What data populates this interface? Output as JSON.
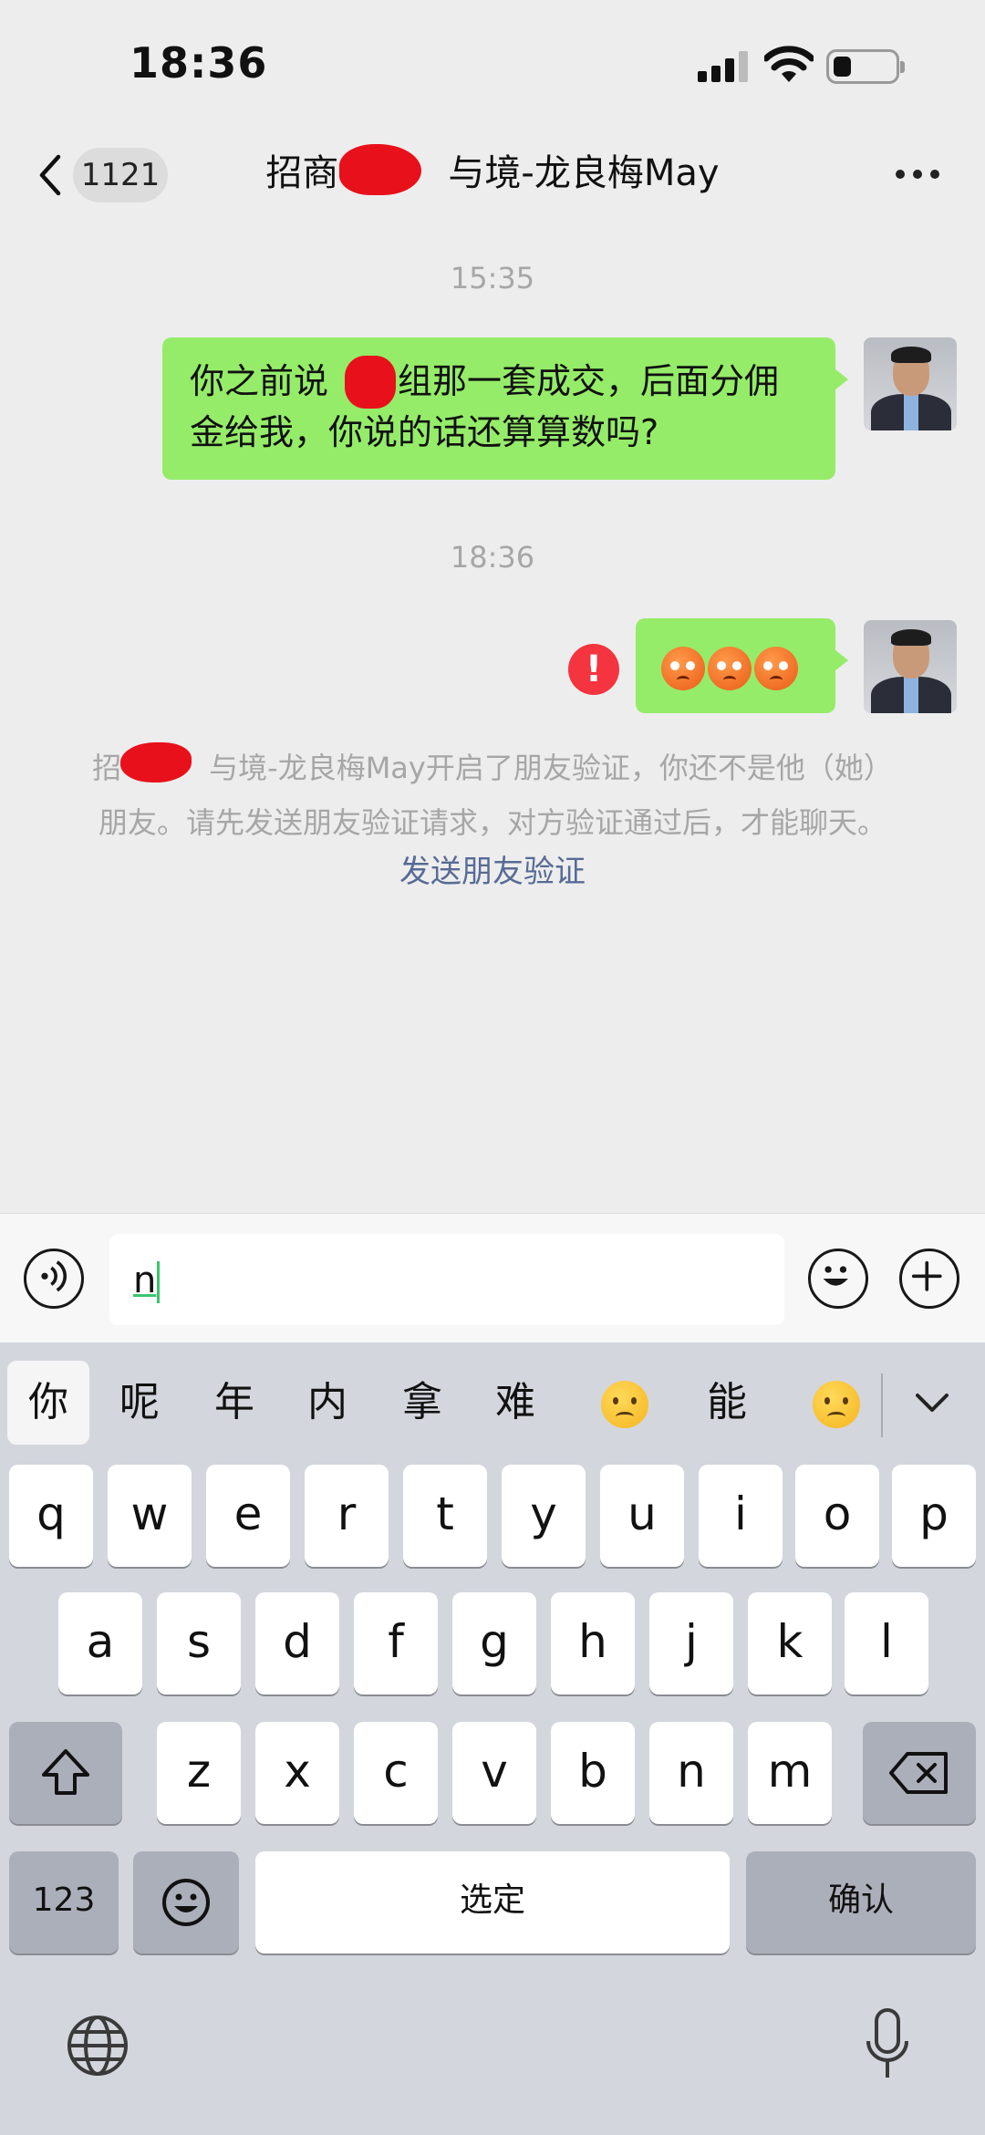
{
  "status_bar": {
    "time": "18:36",
    "battery_level": 0.3
  },
  "header": {
    "back_count": "1121",
    "title": "招商　　　与境-龙良梅May"
  },
  "messages": {
    "timestamp_1": "15:35",
    "msg1_line1": "你之前说　　组那一套成交，后面分佣",
    "msg1_line2": "金给我，你说的话还算算数吗?",
    "timestamp_2": "18:36",
    "error_mark": "!",
    "system_notice_line1": "招　　　与境-龙良梅May开启了朋友验证，你还不是他（她）",
    "system_notice_line2": "朋友。请先发送朋友验证请求，对方验证通过后，才能聊天。",
    "verify_link": "发送朋友验证"
  },
  "input": {
    "value": "n"
  },
  "keyboard": {
    "candidates": [
      "你",
      "呢",
      "年",
      "内",
      "拿",
      "难",
      "😟",
      "能",
      "😔"
    ],
    "row1": [
      "q",
      "w",
      "e",
      "r",
      "t",
      "y",
      "u",
      "i",
      "o",
      "p"
    ],
    "row2": [
      "a",
      "s",
      "d",
      "f",
      "g",
      "h",
      "j",
      "k",
      "l"
    ],
    "row3": [
      "z",
      "x",
      "c",
      "v",
      "b",
      "n",
      "m"
    ],
    "numbers_key": "123",
    "space_key": "选定",
    "confirm_key": "确认"
  },
  "colors": {
    "bubble_green": "#95ec69",
    "link_blue": "#576b95",
    "error_red": "#f4343f",
    "background": "#ededed"
  },
  "icons": [
    "back-chevron-icon",
    "more-icon",
    "voice-icon",
    "emoji-icon",
    "plus-icon",
    "shift-icon",
    "backspace-icon",
    "globe-icon",
    "mic-icon"
  ]
}
